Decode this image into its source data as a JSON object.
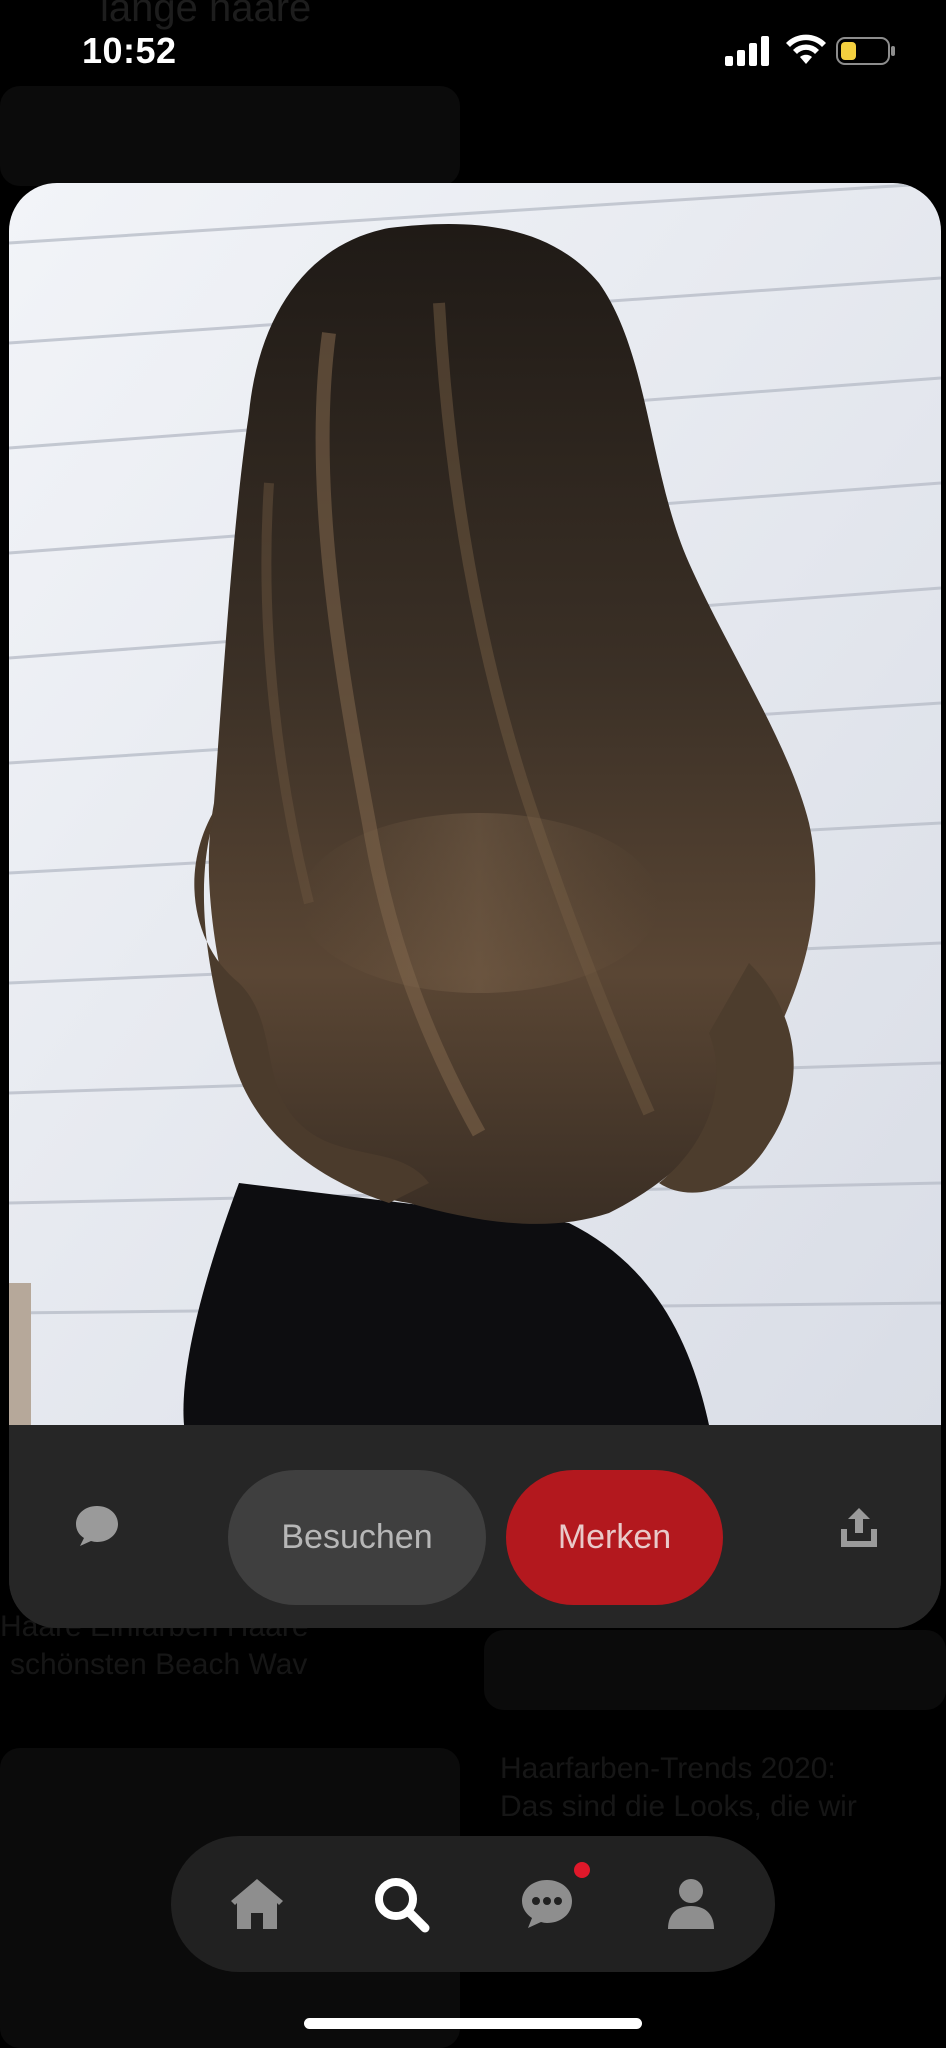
{
  "status_bar": {
    "time": "10:52"
  },
  "background_feed": {
    "top_title": "lange haare",
    "left_pin_title_line1": "Haare Einfärben Haare",
    "left_pin_title_line2": "schönsten Beach Wav",
    "right_pin_title_line1": "Haarfarben-Trends 2020:",
    "right_pin_title_line2": "Das sind die Looks, die wir"
  },
  "pin": {
    "image_icon": "long-brown-wavy-hair-photo"
  },
  "actions": {
    "comment_icon": "speech-bubble-icon",
    "visit_label": "Besuchen",
    "save_label": "Merken",
    "share_icon": "share-upload-icon"
  },
  "tabbar": {
    "items": [
      "home",
      "search",
      "messages",
      "profile"
    ],
    "messages_has_notification": true
  },
  "colors": {
    "save_button": "#b3181e",
    "visit_button": "#3f3f3f",
    "notification_dot": "#e0182a"
  }
}
